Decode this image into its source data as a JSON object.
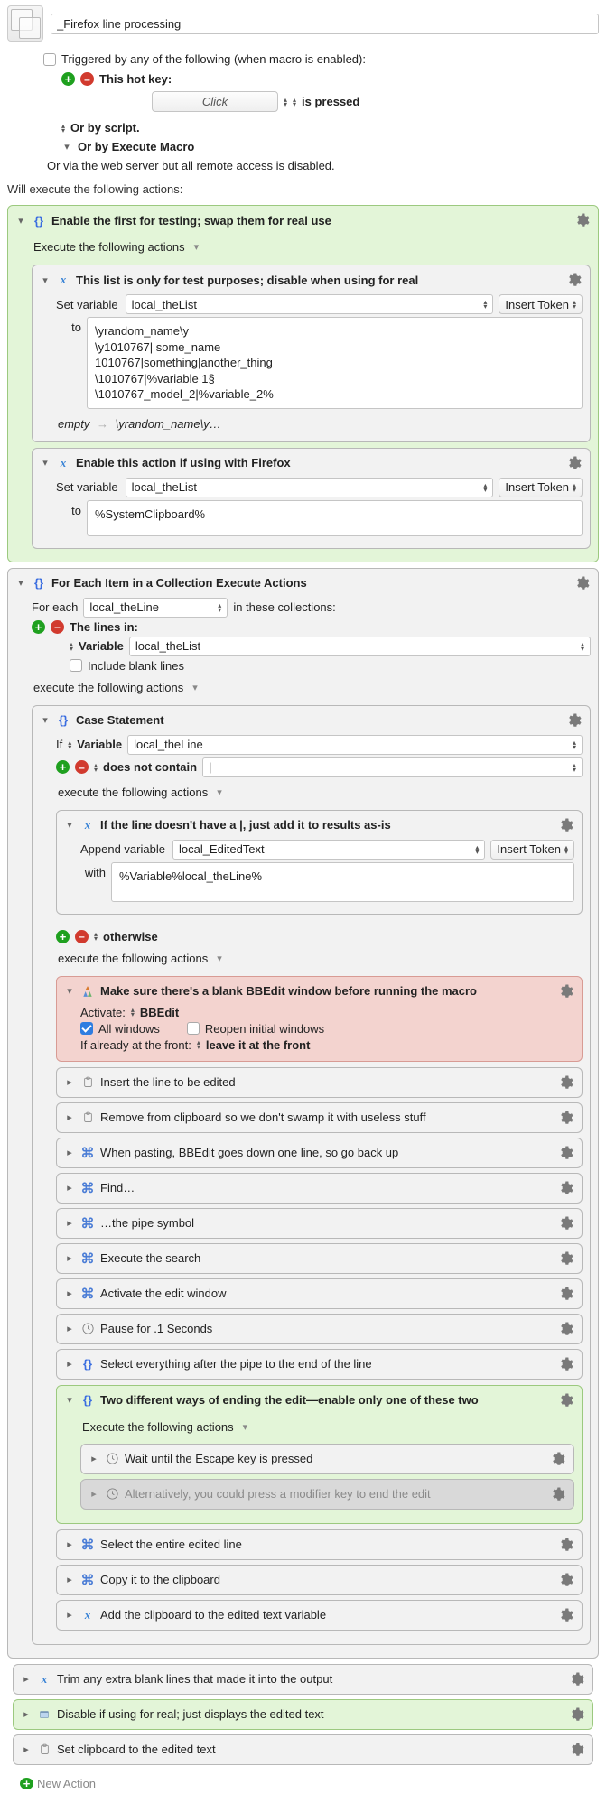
{
  "macro_title": "_Firefox line processing",
  "trigger_header": "Triggered by any of the following (when macro is enabled):",
  "hotkey_label": "This hot key:",
  "click_label": "Click",
  "is_pressed": "is pressed",
  "or_script": "Or by script.",
  "or_execmacro": "Or by Execute Macro",
  "or_web": "Or via the web server but all remote access is disabled.",
  "will_execute": "Will execute the following actions:",
  "exec_actions": "Execute the following actions",
  "exec_actions_lower": "execute the following actions",
  "a_enable_first": "Enable the first for testing; swap them for real use",
  "a_testlist_title": "This list is only for test purposes; disable when using for real",
  "set_variable": "Set variable",
  "var_theList": "local_theList",
  "insert_token": "Insert Token",
  "to": "to",
  "testlist_value": "\\yrandom_name\\y\n\\y1010767| some_name\n1010767|something|another_thing\n\\1010767|%variable 1§\n\\1010767_model_2|%variable_2%",
  "testlist_footnote_left": "empty",
  "testlist_footnote_right": "\\yrandom_name\\y…",
  "a_enable_ff_title": "Enable this action if using with Firefox",
  "sys_clipboard": "%SystemClipboard%",
  "a_foreach_title": "For Each Item in a Collection Execute Actions",
  "for_each": "For each",
  "var_theLine": "local_theLine",
  "in_collections": "in these collections:",
  "lines_in": "The lines in:",
  "variable_label": "Variable",
  "include_blank": "Include blank lines",
  "a_case_title": "Case Statement",
  "if": "If",
  "does_not_contain": "does not contain",
  "pipe": "|",
  "a_append_title": "If the line doesn't have a |, just add it to results as-is",
  "append_variable": "Append variable",
  "var_edited": "local_EditedText",
  "with": "with",
  "append_value": "%Variable%local_theLine%",
  "otherwise": "otherwise",
  "a_bbedit_title": "Make sure there's a blank BBEdit window before running the macro",
  "activate": "Activate:",
  "bbedit": "BBEdit",
  "all_windows": "All windows",
  "reopen": "Reopen initial windows",
  "if_front": "If already at the front:",
  "leave_front": "leave it at the front",
  "acts_other": [
    {
      "icon": "clip",
      "label": "Insert the line to be edited"
    },
    {
      "icon": "clip",
      "label": "Remove from clipboard so we don't swamp it with useless stuff"
    },
    {
      "icon": "cmd",
      "label": "When pasting, BBEdit goes down one line, so go back up"
    },
    {
      "icon": "cmd",
      "label": "Find…"
    },
    {
      "icon": "cmd",
      "label": "…the pipe symbol"
    },
    {
      "icon": "cmd",
      "label": "Execute the search"
    },
    {
      "icon": "cmd",
      "label": "Activate the edit window"
    },
    {
      "icon": "clock",
      "label": "Pause for .1 Seconds"
    },
    {
      "icon": "braces",
      "label": "Select everything after the pipe to the end of the line"
    }
  ],
  "a_two_ways": "Two different ways of ending the edit—enable only one of these two",
  "wait_escape": "Wait until the Escape key is pressed",
  "alt_modifier": "Alternatively, you could press a modifier key to end the edit",
  "after_two": [
    {
      "icon": "cmd",
      "label": "Select the entire edited line"
    },
    {
      "icon": "cmd",
      "label": "Copy it to the clipboard"
    },
    {
      "icon": "x",
      "label": "Add the clipboard to the edited text variable"
    }
  ],
  "bottom": [
    {
      "icon": "x",
      "bg": "plain",
      "label": "Trim any extra blank lines that made it into the output"
    },
    {
      "icon": "window",
      "bg": "green",
      "label": "Disable if using for real; just displays the edited text"
    },
    {
      "icon": "clip",
      "bg": "plain",
      "label": "Set clipboard to the edited text"
    }
  ],
  "new_action": "New Action"
}
